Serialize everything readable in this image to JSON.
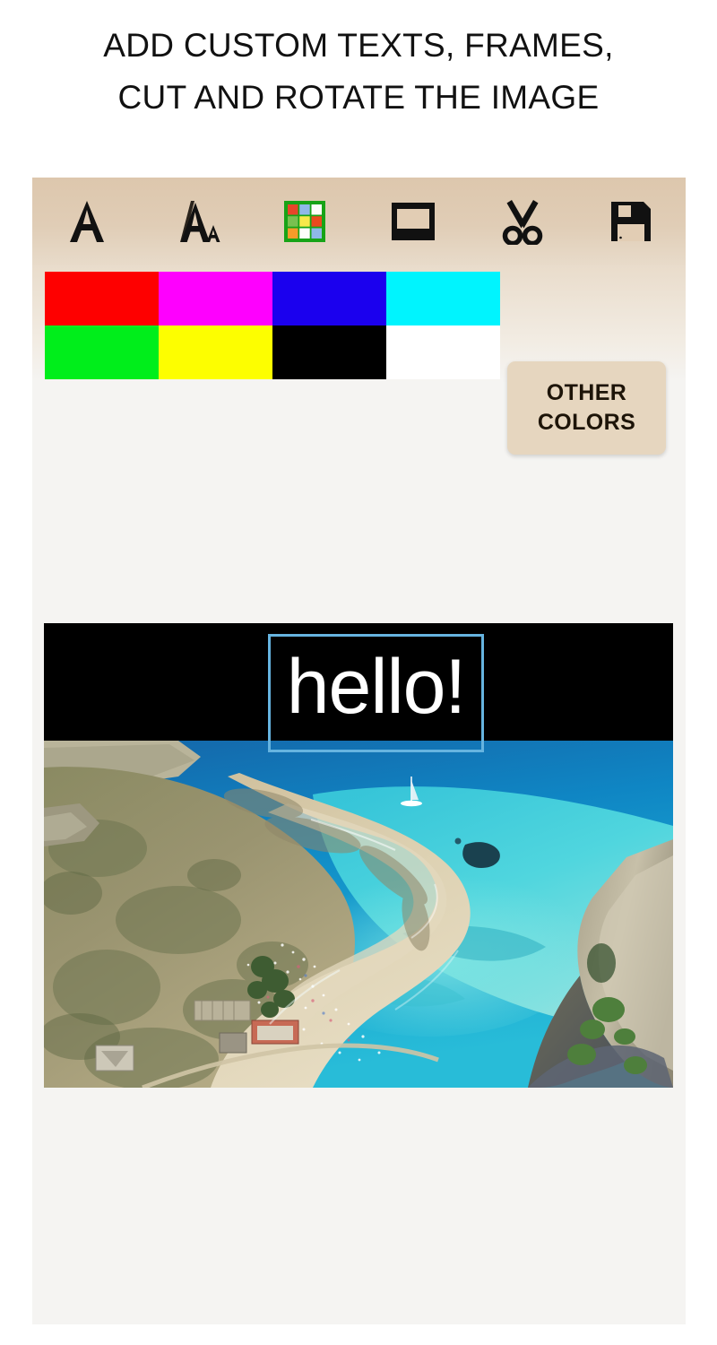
{
  "headline": "ADD CUSTOM TEXTS, FRAMES,\nCUT AND ROTATE THE IMAGE",
  "toolbar": {
    "items": [
      {
        "name": "add-text",
        "icon": "letter-a-icon",
        "label": "A"
      },
      {
        "name": "text-style",
        "icon": "font-style-icon",
        "label": "Aa"
      },
      {
        "name": "color-palette",
        "icon": "color-grid-icon",
        "label": "Colors"
      },
      {
        "name": "frame",
        "icon": "frame-icon",
        "label": "Frame"
      },
      {
        "name": "crop",
        "icon": "scissors-icon",
        "label": "Cut"
      },
      {
        "name": "save",
        "icon": "floppy-disk-icon",
        "label": "Save"
      }
    ]
  },
  "palette": {
    "swatches": [
      {
        "name": "red",
        "hex": "#fe0000"
      },
      {
        "name": "magenta",
        "hex": "#fe00fe"
      },
      {
        "name": "blue",
        "hex": "#1b00ee"
      },
      {
        "name": "cyan",
        "hex": "#00f4fe"
      },
      {
        "name": "green",
        "hex": "#00ee1b"
      },
      {
        "name": "yellow",
        "hex": "#fdfe00"
      },
      {
        "name": "black",
        "hex": "#000000"
      },
      {
        "name": "white",
        "hex": "#ffffff"
      }
    ],
    "other_colors_label": "OTHER\nCOLORS"
  },
  "palette_icon_colors": [
    "#e8452a",
    "#8fb8e8",
    "#fdfdfb",
    "#79c050",
    "#f7e94a",
    "#ea4a1f",
    "#f59b2a",
    "#fdfdfb",
    "#8fb8e8"
  ],
  "editor": {
    "overlay_text": "hello!",
    "overlay_text_color": "#ffffff",
    "selection_border_color": "#66b4e0",
    "band_color": "#000000",
    "photo_alt": "aerial view of turquoise lagoon with sandy beach peninsula and cliffs"
  },
  "colors": {
    "toolbar_top": "#ddc7ad",
    "toolbar_bottom": "#e8dbca",
    "canvas_bg": "#f5f4f2",
    "button_bg": "#e6d6bf",
    "page_bg": "#ffffff",
    "headline_color": "#111111"
  }
}
